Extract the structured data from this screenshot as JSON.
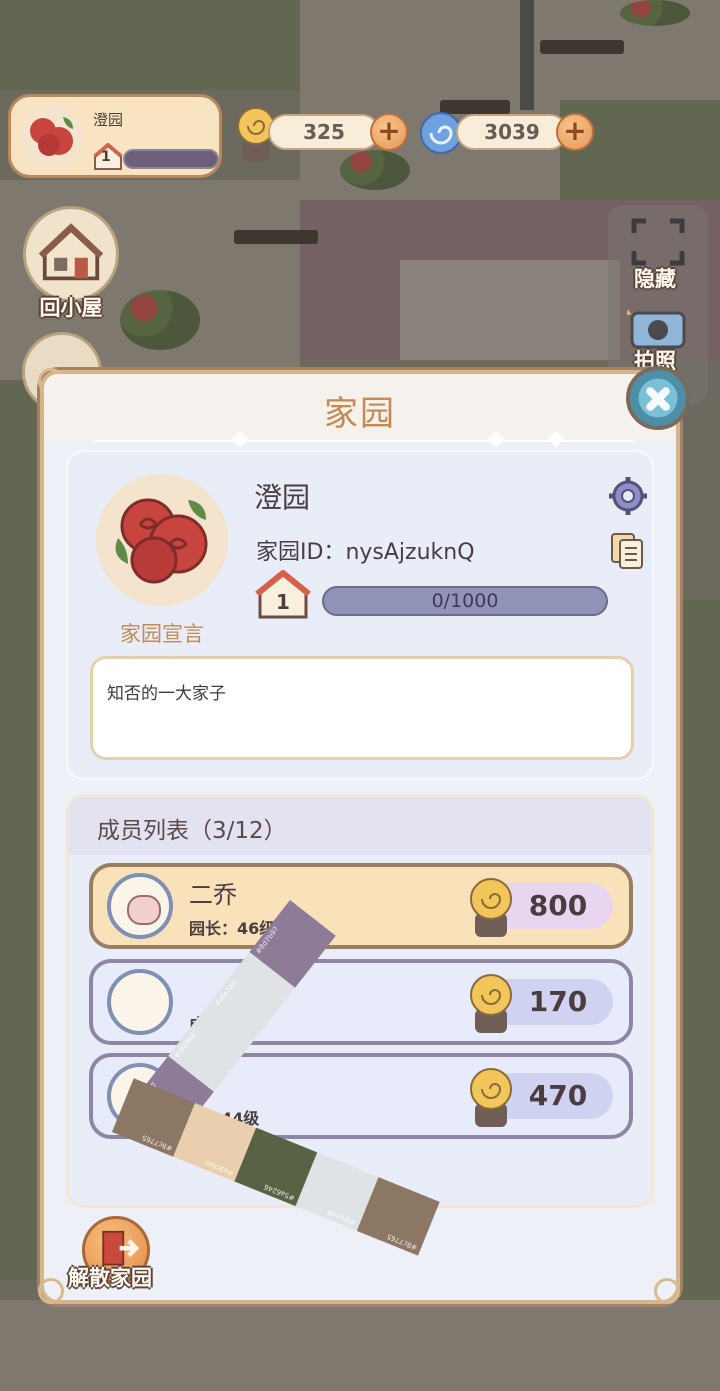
{
  "hud": {
    "home_name": "澄园",
    "home_level": "1",
    "snail_currency": "325",
    "shell_currency": "3039"
  },
  "side_buttons": {
    "back_home": "回小屋",
    "hide": "隐藏",
    "photo": "拍照"
  },
  "modal": {
    "title": "家园",
    "name": "澄园",
    "id_label": "家园ID：",
    "id_value": "nysAjzuknQ",
    "level": "1",
    "exp": "0/1000",
    "declaration_label": "家园宣言",
    "declaration_text": "知否的一大家子",
    "members_title": "成员列表（3/12）",
    "members": [
      {
        "name": "二乔",
        "role": "园长：46级",
        "score": "800",
        "is_me": true
      },
      {
        "name": "",
        "role": "成员",
        "score": "170",
        "is_me": false
      },
      {
        "name": "",
        "role": "员：44级",
        "score": "470",
        "is_me": false
      }
    ],
    "disband_label": "解散家园"
  },
  "overlay_swatches": [
    {
      "hex": "#8d7b97",
      "label": "#8d7b97"
    },
    {
      "hex": "#dfe3e6",
      "label": "#dfe3e6"
    },
    {
      "hex": "#5a6246",
      "label": "#5a6246"
    },
    {
      "hex": "#e9cfad",
      "label": "#e9cfad"
    },
    {
      "hex": "#8c7765",
      "label": "#8c7765"
    }
  ],
  "colors": {
    "modal_title": "#c48a52",
    "modal_border": "#d7b58b",
    "exp_bar": "#9193b9",
    "leader_row": "#f9e1b9"
  }
}
